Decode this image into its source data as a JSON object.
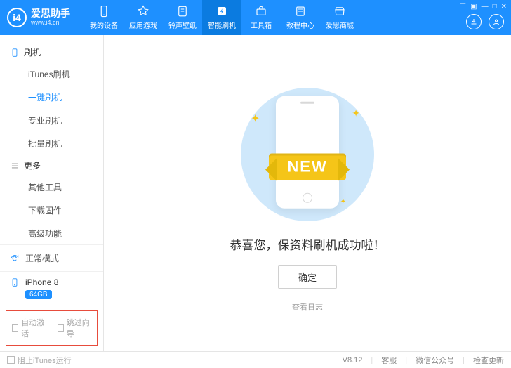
{
  "brand": {
    "title": "爱思助手",
    "subtitle": "www.i4.cn",
    "logo_letters": "i4"
  },
  "nav": [
    {
      "label": "我的设备",
      "icon": "phone"
    },
    {
      "label": "应用游戏",
      "icon": "apps"
    },
    {
      "label": "铃声壁纸",
      "icon": "music"
    },
    {
      "label": "智能刷机",
      "icon": "flash",
      "active": true
    },
    {
      "label": "工具箱",
      "icon": "toolbox"
    },
    {
      "label": "教程中心",
      "icon": "book"
    },
    {
      "label": "爱思商城",
      "icon": "store"
    }
  ],
  "sidebar": {
    "group1": {
      "title": "刷机",
      "items": [
        "iTunes刷机",
        "一键刷机",
        "专业刷机",
        "批量刷机"
      ],
      "active_index": 1
    },
    "group2": {
      "title": "更多",
      "items": [
        "其他工具",
        "下载固件",
        "高级功能"
      ]
    },
    "mode": "正常模式",
    "device": {
      "name": "iPhone 8",
      "storage": "64GB"
    },
    "checks": {
      "auto_activate": "自动激活",
      "skip_wizard": "跳过向导"
    }
  },
  "main": {
    "ribbon": "NEW",
    "success_text": "恭喜您，保资料刷机成功啦！",
    "ok_label": "确定",
    "log_label": "查看日志"
  },
  "statusbar": {
    "block_itunes": "阻止iTunes运行",
    "version": "V8.12",
    "links": [
      "客服",
      "微信公众号",
      "检查更新"
    ]
  }
}
